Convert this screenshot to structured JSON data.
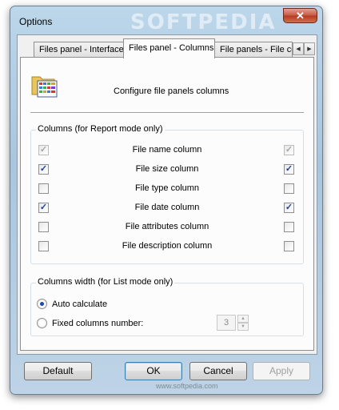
{
  "window": {
    "title": "Options",
    "watermark": "SOFTPEDIA",
    "close_symbol": "✕"
  },
  "tabs": [
    {
      "label": "Files panel - Interface",
      "active": false
    },
    {
      "label": "Files panel - Columns",
      "active": true
    },
    {
      "label": "File panels - File colo",
      "active": false
    }
  ],
  "tab_scroll": {
    "left": "◀",
    "right": "▶"
  },
  "header": {
    "icon": "folder-columns-icon",
    "text": "Configure file panels columns"
  },
  "columns_group": {
    "title": "Columns (for Report mode only)",
    "rows": [
      {
        "label": "File name column",
        "left_checked": true,
        "right_checked": true,
        "disabled": true
      },
      {
        "label": "File size column",
        "left_checked": true,
        "right_checked": true,
        "disabled": false
      },
      {
        "label": "File type column",
        "left_checked": false,
        "right_checked": false,
        "disabled": false
      },
      {
        "label": "File date column",
        "left_checked": true,
        "right_checked": true,
        "disabled": false
      },
      {
        "label": "File attributes column",
        "left_checked": false,
        "right_checked": false,
        "disabled": false
      },
      {
        "label": "File description column",
        "left_checked": false,
        "right_checked": false,
        "disabled": false
      }
    ],
    "check_mark": "✓"
  },
  "width_group": {
    "title": "Columns width (for List mode only)",
    "auto_label": "Auto calculate",
    "fixed_label": "Fixed columns number:",
    "selected": "auto",
    "fixed_value": "3",
    "spin_up": "▲",
    "spin_down": "▼"
  },
  "buttons": {
    "default_label": "Default",
    "ok_label": "OK",
    "cancel_label": "Cancel",
    "apply_label": "Apply"
  },
  "footer_watermark": "www.softpedia.com"
}
